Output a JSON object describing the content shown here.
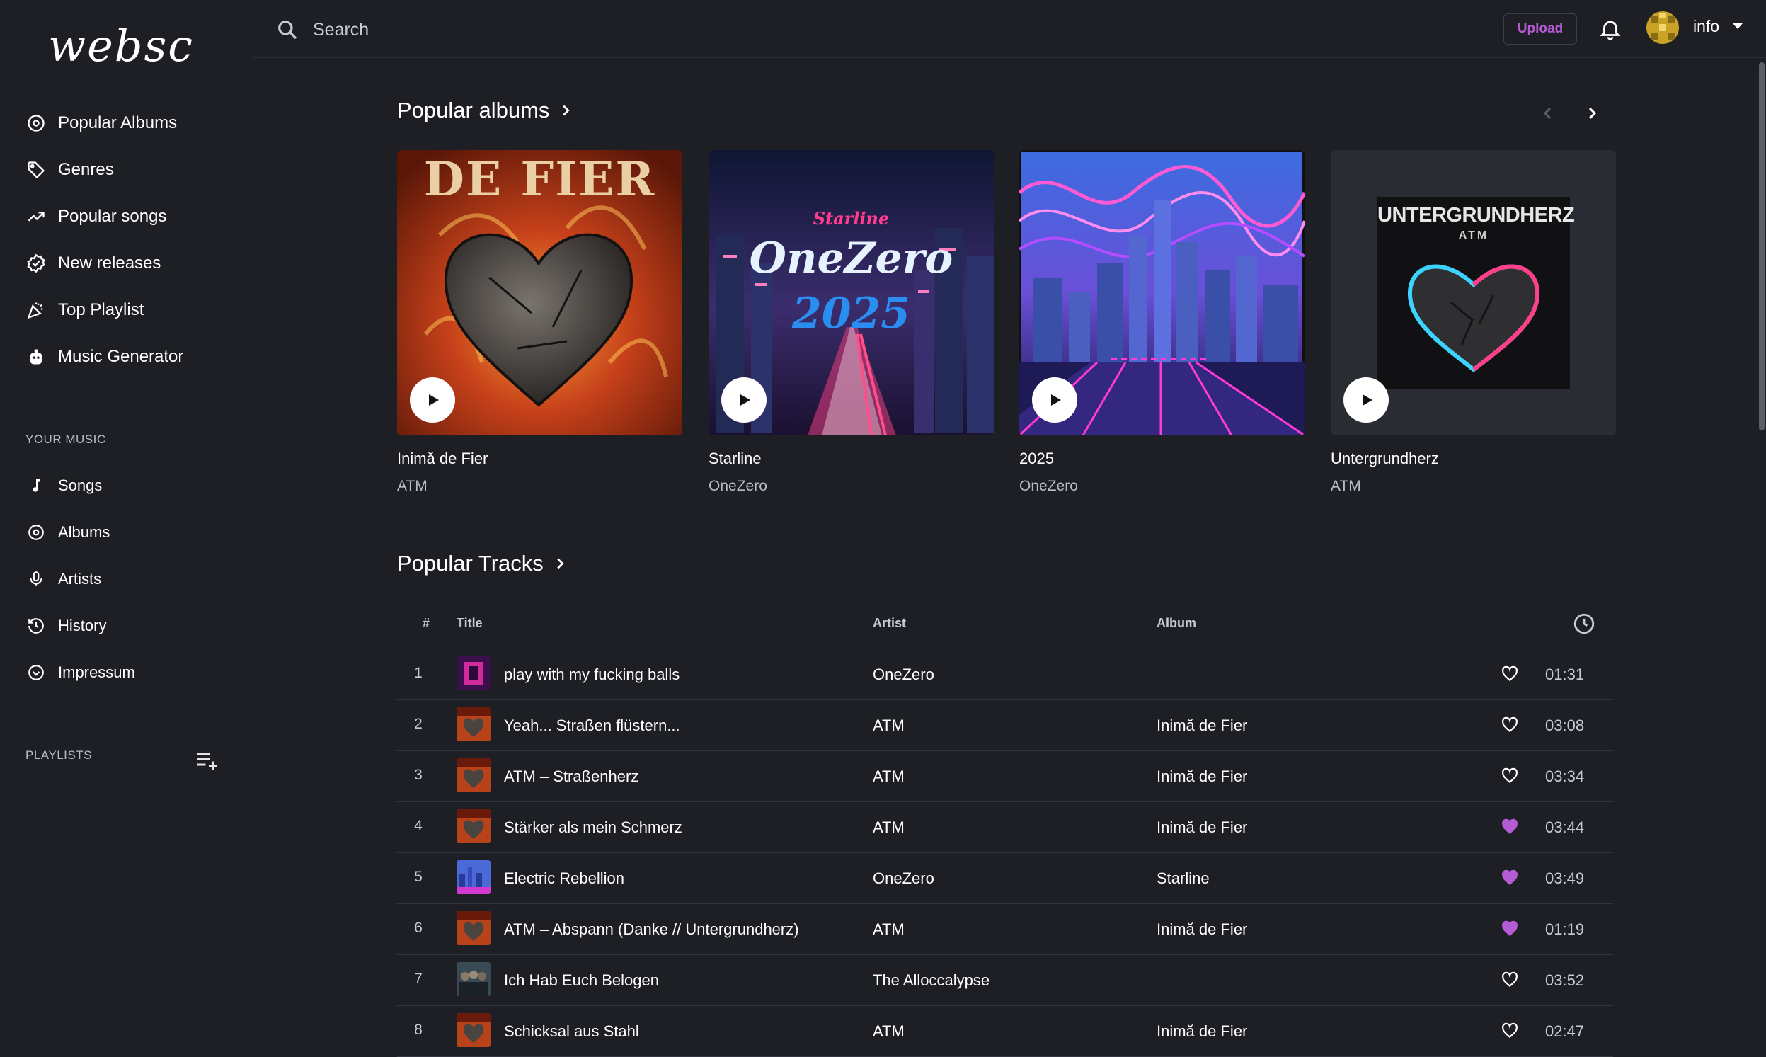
{
  "app": {
    "logo_text": "websc"
  },
  "nav": {
    "items": [
      {
        "label": "Popular Albums",
        "icon": "disc-icon"
      },
      {
        "label": "Genres",
        "icon": "tag-icon"
      },
      {
        "label": "Popular songs",
        "icon": "trending-icon"
      },
      {
        "label": "New releases",
        "icon": "badge-check-icon"
      },
      {
        "label": "Top Playlist",
        "icon": "party-icon"
      },
      {
        "label": "Music Generator",
        "icon": "robot-icon"
      }
    ],
    "your_music_label": "YOUR MUSIC",
    "your_music": [
      {
        "label": "Songs",
        "icon": "music-note-icon"
      },
      {
        "label": "Albums",
        "icon": "disc-icon"
      },
      {
        "label": "Artists",
        "icon": "microphone-icon"
      },
      {
        "label": "History",
        "icon": "history-icon"
      },
      {
        "label": "Impressum",
        "icon": "chevron-circle-icon"
      }
    ],
    "playlists_label": "PLAYLISTS"
  },
  "topbar": {
    "search_placeholder": "Search",
    "upload_label": "Upload",
    "user_name": "info"
  },
  "popular_albums": {
    "title": "Popular albums",
    "albums": [
      {
        "title": "Inimă de Fier",
        "artist": "ATM",
        "cover_text": "DE FIER"
      },
      {
        "title": "Starline",
        "artist": "OneZero",
        "cover_text": "OneZero",
        "cover_subtext": "2025",
        "cover_top": "Starline"
      },
      {
        "title": "2025",
        "artist": "OneZero"
      },
      {
        "title": "Untergrundherz",
        "artist": "ATM",
        "cover_text": "UNTERGRUNDHERZ",
        "cover_subtext": "ATM"
      }
    ]
  },
  "popular_tracks": {
    "title": "Popular Tracks",
    "columns": {
      "num": "#",
      "title": "Title",
      "artist": "Artist",
      "album": "Album"
    },
    "rows": [
      {
        "num": "1",
        "title": "play with my fucking balls",
        "artist": "OneZero",
        "album": "",
        "liked": false,
        "duration": "01:31",
        "thumb": "purple"
      },
      {
        "num": "2",
        "title": "Yeah... Straßen flüstern...",
        "artist": "ATM",
        "album": "Inimă de Fier",
        "liked": false,
        "duration": "03:08",
        "thumb": "fire"
      },
      {
        "num": "3",
        "title": "ATM – Straßenherz",
        "artist": "ATM",
        "album": "Inimă de Fier",
        "liked": false,
        "duration": "03:34",
        "thumb": "fire"
      },
      {
        "num": "4",
        "title": "Stärker als mein Schmerz",
        "artist": "ATM",
        "album": "Inimă de Fier",
        "liked": true,
        "duration": "03:44",
        "thumb": "fire"
      },
      {
        "num": "5",
        "title": "Electric Rebellion",
        "artist": "OneZero",
        "album": "Starline",
        "liked": true,
        "duration": "03:49",
        "thumb": "city"
      },
      {
        "num": "6",
        "title": "ATM – Abspann (Danke // Untergrundherz)",
        "artist": "ATM",
        "album": "Inimă de Fier",
        "liked": true,
        "duration": "01:19",
        "thumb": "fire"
      },
      {
        "num": "7",
        "title": "Ich Hab Euch Belogen",
        "artist": "The Alloccalypse",
        "album": "",
        "liked": false,
        "duration": "03:52",
        "thumb": "band"
      },
      {
        "num": "8",
        "title": "Schicksal aus Stahl",
        "artist": "ATM",
        "album": "Inimă de Fier",
        "liked": false,
        "duration": "02:47",
        "thumb": "fire"
      }
    ]
  },
  "colors": {
    "accent": "#b65bd6",
    "background": "#1d1f25",
    "liked_heart": "#b65bd6"
  }
}
